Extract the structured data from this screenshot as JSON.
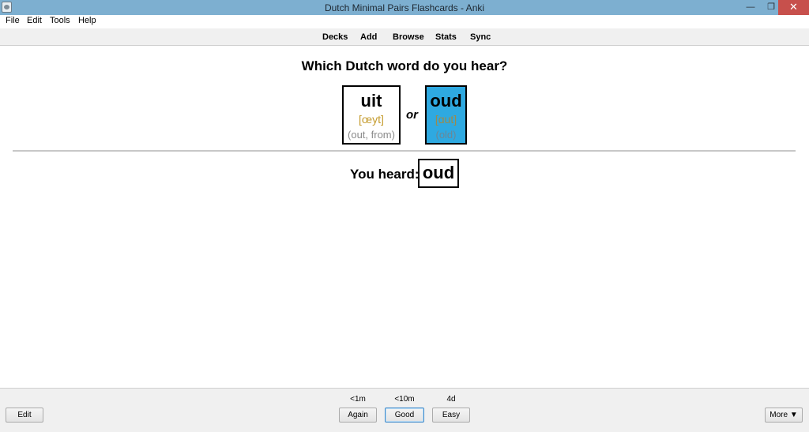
{
  "window": {
    "title": "Dutch Minimal Pairs Flashcards - Anki",
    "minimize_glyph": "—",
    "maximize_glyph": "❐",
    "close_glyph": "✕"
  },
  "menu": {
    "items": [
      "File",
      "Edit",
      "Tools",
      "Help"
    ]
  },
  "toolbar": {
    "links": [
      "Decks",
      "Add",
      "Browse",
      "Stats",
      "Sync"
    ]
  },
  "card": {
    "question": "Which Dutch word do you hear?",
    "options": [
      {
        "word": "uit",
        "ipa": "[œyt]",
        "gloss": "(out, from)"
      },
      {
        "word": "oud",
        "ipa": "[ɑut]",
        "gloss": "(old)"
      }
    ],
    "or_label": "or",
    "heard_label": "You heard:",
    "heard_word": "oud",
    "highlight_color": "#2ea9e1"
  },
  "answer_bar": {
    "edit_label": "Edit",
    "buttons": [
      {
        "label": "Again",
        "interval": "<1m"
      },
      {
        "label": "Good",
        "interval": "<10m"
      },
      {
        "label": "Easy",
        "interval": "4d"
      }
    ],
    "more_label": "More ▼"
  }
}
